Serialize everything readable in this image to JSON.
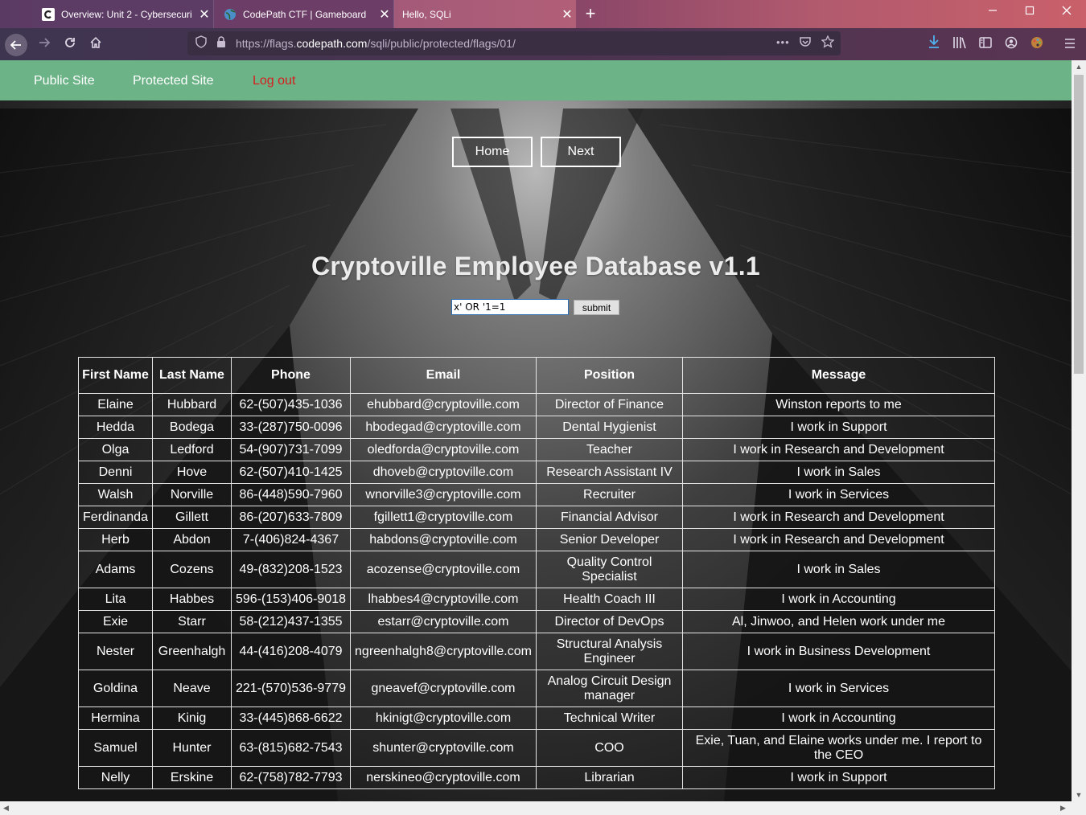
{
  "browser": {
    "tabs": [
      {
        "title": "Overview: Unit 2 - Cybersecuri",
        "close": "✕"
      },
      {
        "title": "CodePath CTF | Gameboard",
        "close": "✕"
      },
      {
        "title": "Hello, SQLi",
        "close": "✕"
      }
    ],
    "new_tab": "+",
    "url_prefix": "https://flags.",
    "url_host": "codepath.com",
    "url_path": "/sqli/public/protected/flags/01/",
    "url_more": "•••"
  },
  "site_nav": {
    "public": "Public Site",
    "protected": "Protected Site",
    "logout": "Log out"
  },
  "buttons": {
    "home": "Home",
    "next": "Next",
    "submit": "submit"
  },
  "page_title": "Cryptoville Employee Database v1.1",
  "search_value": "x' OR '1=1",
  "table": {
    "headers": [
      "First Name",
      "Last Name",
      "Phone",
      "Email",
      "Position",
      "Message"
    ],
    "rows": [
      [
        "Elaine",
        "Hubbard",
        "62-(507)435-1036",
        "ehubbard@cryptoville.com",
        "Director of Finance",
        "Winston reports to me"
      ],
      [
        "Hedda",
        "Bodega",
        "33-(287)750-0096",
        "hbodegad@cryptoville.com",
        "Dental Hygienist",
        "I work in Support"
      ],
      [
        "Olga",
        "Ledford",
        "54-(907)731-7099",
        "oledforda@cryptoville.com",
        "Teacher",
        "I work in Research and Development"
      ],
      [
        "Denni",
        "Hove",
        "62-(507)410-1425",
        "dhoveb@cryptoville.com",
        "Research Assistant IV",
        "I work in Sales"
      ],
      [
        "Walsh",
        "Norville",
        "86-(448)590-7960",
        "wnorville3@cryptoville.com",
        "Recruiter",
        "I work in Services"
      ],
      [
        "Ferdinanda",
        "Gillett",
        "86-(207)633-7809",
        "fgillett1@cryptoville.com",
        "Financial Advisor",
        "I work in Research and Development"
      ],
      [
        "Herb",
        "Abdon",
        "7-(406)824-4367",
        "habdons@cryptoville.com",
        "Senior Developer",
        "I work in Research and Development"
      ],
      [
        "Adams",
        "Cozens",
        "49-(832)208-1523",
        "acozense@cryptoville.com",
        "Quality Control Specialist",
        "I work in Sales"
      ],
      [
        "Lita",
        "Habbes",
        "596-(153)406-9018",
        "lhabbes4@cryptoville.com",
        "Health Coach III",
        "I work in Accounting"
      ],
      [
        "Exie",
        "Starr",
        "58-(212)437-1355",
        "estarr@cryptoville.com",
        "Director of DevOps",
        "Al, Jinwoo, and Helen work under me"
      ],
      [
        "Nester",
        "Greenhalgh",
        "44-(416)208-4079",
        "ngreenhalgh8@cryptoville.com",
        "Structural Analysis Engineer",
        "I work in Business Development"
      ],
      [
        "Goldina",
        "Neave",
        "221-(570)536-9779",
        "gneavef@cryptoville.com",
        "Analog Circuit Design manager",
        "I work in Services"
      ],
      [
        "Hermina",
        "Kinig",
        "33-(445)868-6622",
        "hkinigt@cryptoville.com",
        "Technical Writer",
        "I work in Accounting"
      ],
      [
        "Samuel",
        "Hunter",
        "63-(815)682-7543",
        "shunter@cryptoville.com",
        "COO",
        "Exie, Tuan, and Elaine works under me. I report to the CEO"
      ],
      [
        "Nelly",
        "Erskine",
        "62-(758)782-7793",
        "nerskineo@cryptoville.com",
        "Librarian",
        "I work in Support"
      ]
    ]
  },
  "colors": {
    "site_nav_bg": "#6db388",
    "logout": "#d51f1f",
    "tab_gradient_end": "#c9606a"
  },
  "icons": [
    "back-icon",
    "forward-icon",
    "reload-icon",
    "home-icon",
    "shield-icon",
    "lock-icon",
    "pocket-icon",
    "star-icon",
    "download-icon",
    "library-icon",
    "sidebar-icon",
    "account-icon",
    "palette-icon",
    "menu-icon"
  ]
}
